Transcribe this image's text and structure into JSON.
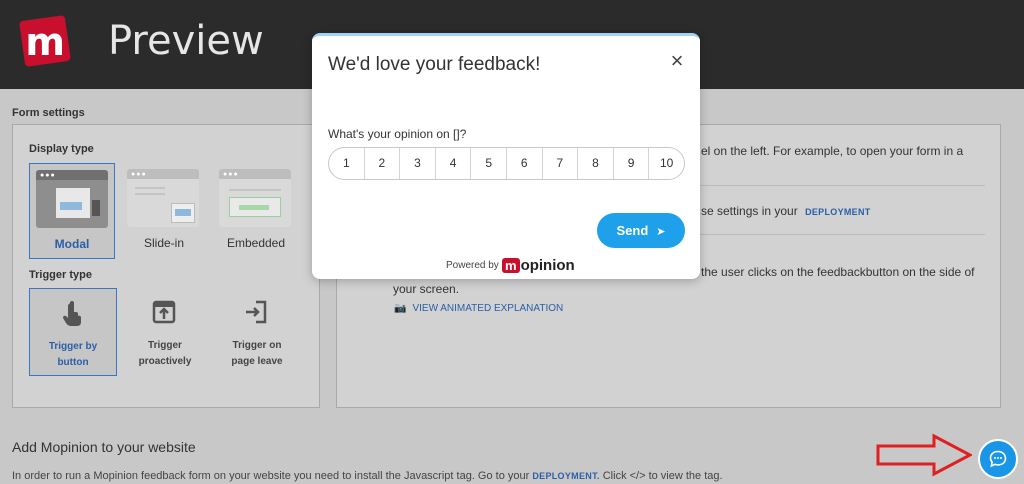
{
  "header": {
    "logo_letter": "m",
    "title": "Preview"
  },
  "form_settings": {
    "label": "Form settings",
    "display_type": {
      "label": "Display type",
      "options": [
        {
          "label": "Modal",
          "selected": true
        },
        {
          "label": "Slide-in",
          "selected": false
        },
        {
          "label": "Embedded",
          "selected": false
        }
      ]
    },
    "trigger_type": {
      "label": "Trigger type",
      "options": [
        {
          "line1": "Trigger by",
          "line2": "button",
          "icon": "tap-hand-icon",
          "selected": true
        },
        {
          "line1": "Trigger",
          "line2": "proactively",
          "icon": "popup-arrow-icon",
          "selected": false
        },
        {
          "line1": "Trigger on",
          "line2": "page leave",
          "icon": "exit-arrow-icon",
          "selected": false
        }
      ]
    }
  },
  "right_panel": {
    "line1": "el on the left. For example, to open your form in a",
    "line2_prefix": "se settings in your",
    "deployment_link": "DEPLOYMENT",
    "line3": "the user clicks on the feedbackbutton on the side of",
    "line4": "your screen.",
    "animated_link": "VIEW ANIMATED EXPLANATION"
  },
  "add_section": {
    "title": "Add Mopinion to your website",
    "text_prefix": "In order to run a Mopinion feedback form on your website you need to install the Javascript tag. Go to your",
    "deployment_link": "DEPLOYMENT.",
    "text_suffix": "Click </> to view the tag."
  },
  "modal": {
    "title": "We'd love your feedback!",
    "close": "×",
    "question": "What's your opinion on []?",
    "scale": [
      "1",
      "2",
      "3",
      "4",
      "5",
      "6",
      "7",
      "8",
      "9",
      "10"
    ],
    "send_label": "Send",
    "powered_by": "Powered by",
    "brand_m": "m",
    "brand_rest": "opinion"
  },
  "colors": {
    "accent": "#1ea0ea",
    "brand": "#c8102e",
    "header": "#2b2b2b",
    "arrow": "#e02020"
  }
}
